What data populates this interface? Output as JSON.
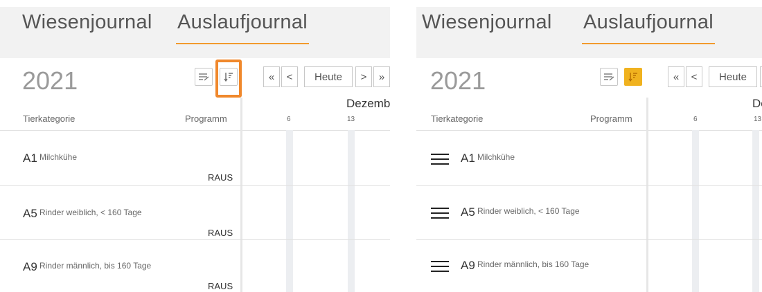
{
  "tabs": [
    {
      "label": "Wiesenjournal"
    },
    {
      "label": "Auslaufjournal"
    }
  ],
  "year": "2021",
  "toolbar": {
    "edit_icon": "list-edit-icon",
    "sort_icon": "sort-filter-icon"
  },
  "nav": {
    "first": "«",
    "prev": "<",
    "today": "Heute",
    "next": ">",
    "last": "»"
  },
  "columns": {
    "category": "Tierkategorie",
    "program": "Programm"
  },
  "timeline": {
    "month": "Dezember",
    "weeks": [
      "6",
      "13"
    ]
  },
  "rows": [
    {
      "code": "A1",
      "desc": "Milchkühe",
      "program": "RAUS"
    },
    {
      "code": "A5",
      "desc": "Rinder weiblich, < 160 Tage",
      "program": "RAUS"
    },
    {
      "code": "A9",
      "desc": "Rinder männlich, bis 160 Tage",
      "program": "RAUS"
    }
  ],
  "colors": {
    "accent": "#f0882c",
    "active_button": "#f0b21f"
  }
}
